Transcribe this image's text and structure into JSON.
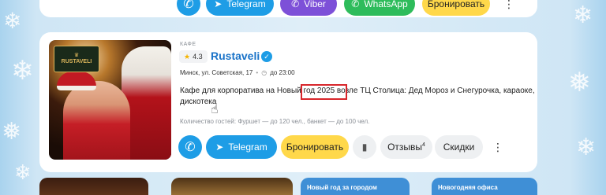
{
  "top_actions": {
    "telegram_label": "Telegram",
    "viber_label": "Viber",
    "whatsapp_label": "WhatsApp",
    "book_label": "Бронировать"
  },
  "venue": {
    "category": "КАФЕ",
    "rating": "4.3",
    "name": "Rustaveli",
    "logo_text": "RUSTAVELI",
    "address": "Минск, ул. Советская, 17",
    "hours": "до 23:00",
    "description": "Кафе для корпоратива на Новый год 2025 возле ТЦ Столица: Дед Мороз и Снегурочка, караоке, дискотека",
    "guests": "Количество гостей: Фуршет — до 120 чел., банкет — до 100 чел."
  },
  "card_actions": {
    "telegram_label": "Telegram",
    "book_label": "Бронировать",
    "reviews_label": "Отзывы",
    "reviews_count": "4",
    "discounts_label": "Скидки"
  },
  "bottom_cards": {
    "card3_text": "Новый год за городом",
    "card4_text": "Новогодняя офиса"
  },
  "colors": {
    "accent_blue": "#1e9de6",
    "link_blue": "#1a73c8",
    "book_yellow": "#ffd84a",
    "viber": "#7d50d8",
    "whatsapp": "#2ebc5b",
    "highlight_red": "#d8262b"
  }
}
